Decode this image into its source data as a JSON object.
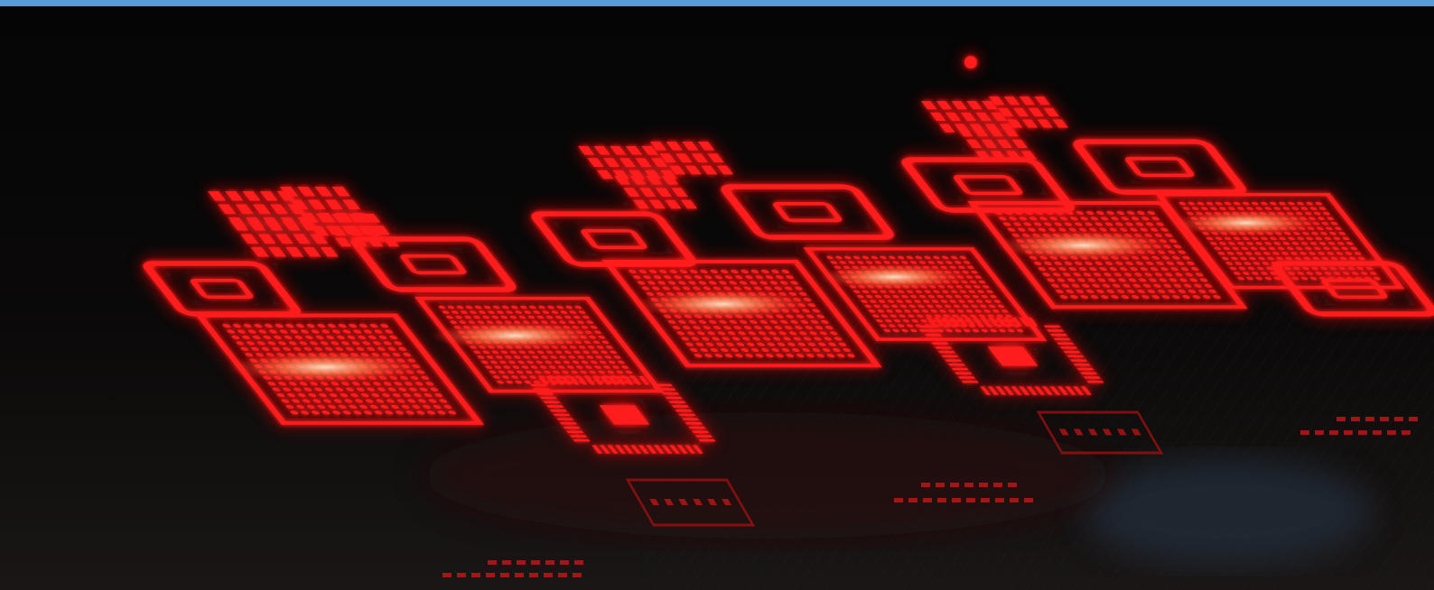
{
  "frame": {
    "accent_color": "#5b9bd5",
    "background_color": "#050505"
  },
  "photo": {
    "glow_color": "#ff1a1a",
    "hot_color": "#ffd0a0",
    "stencil_color": "#151212",
    "reflection_color": "#28384a"
  }
}
